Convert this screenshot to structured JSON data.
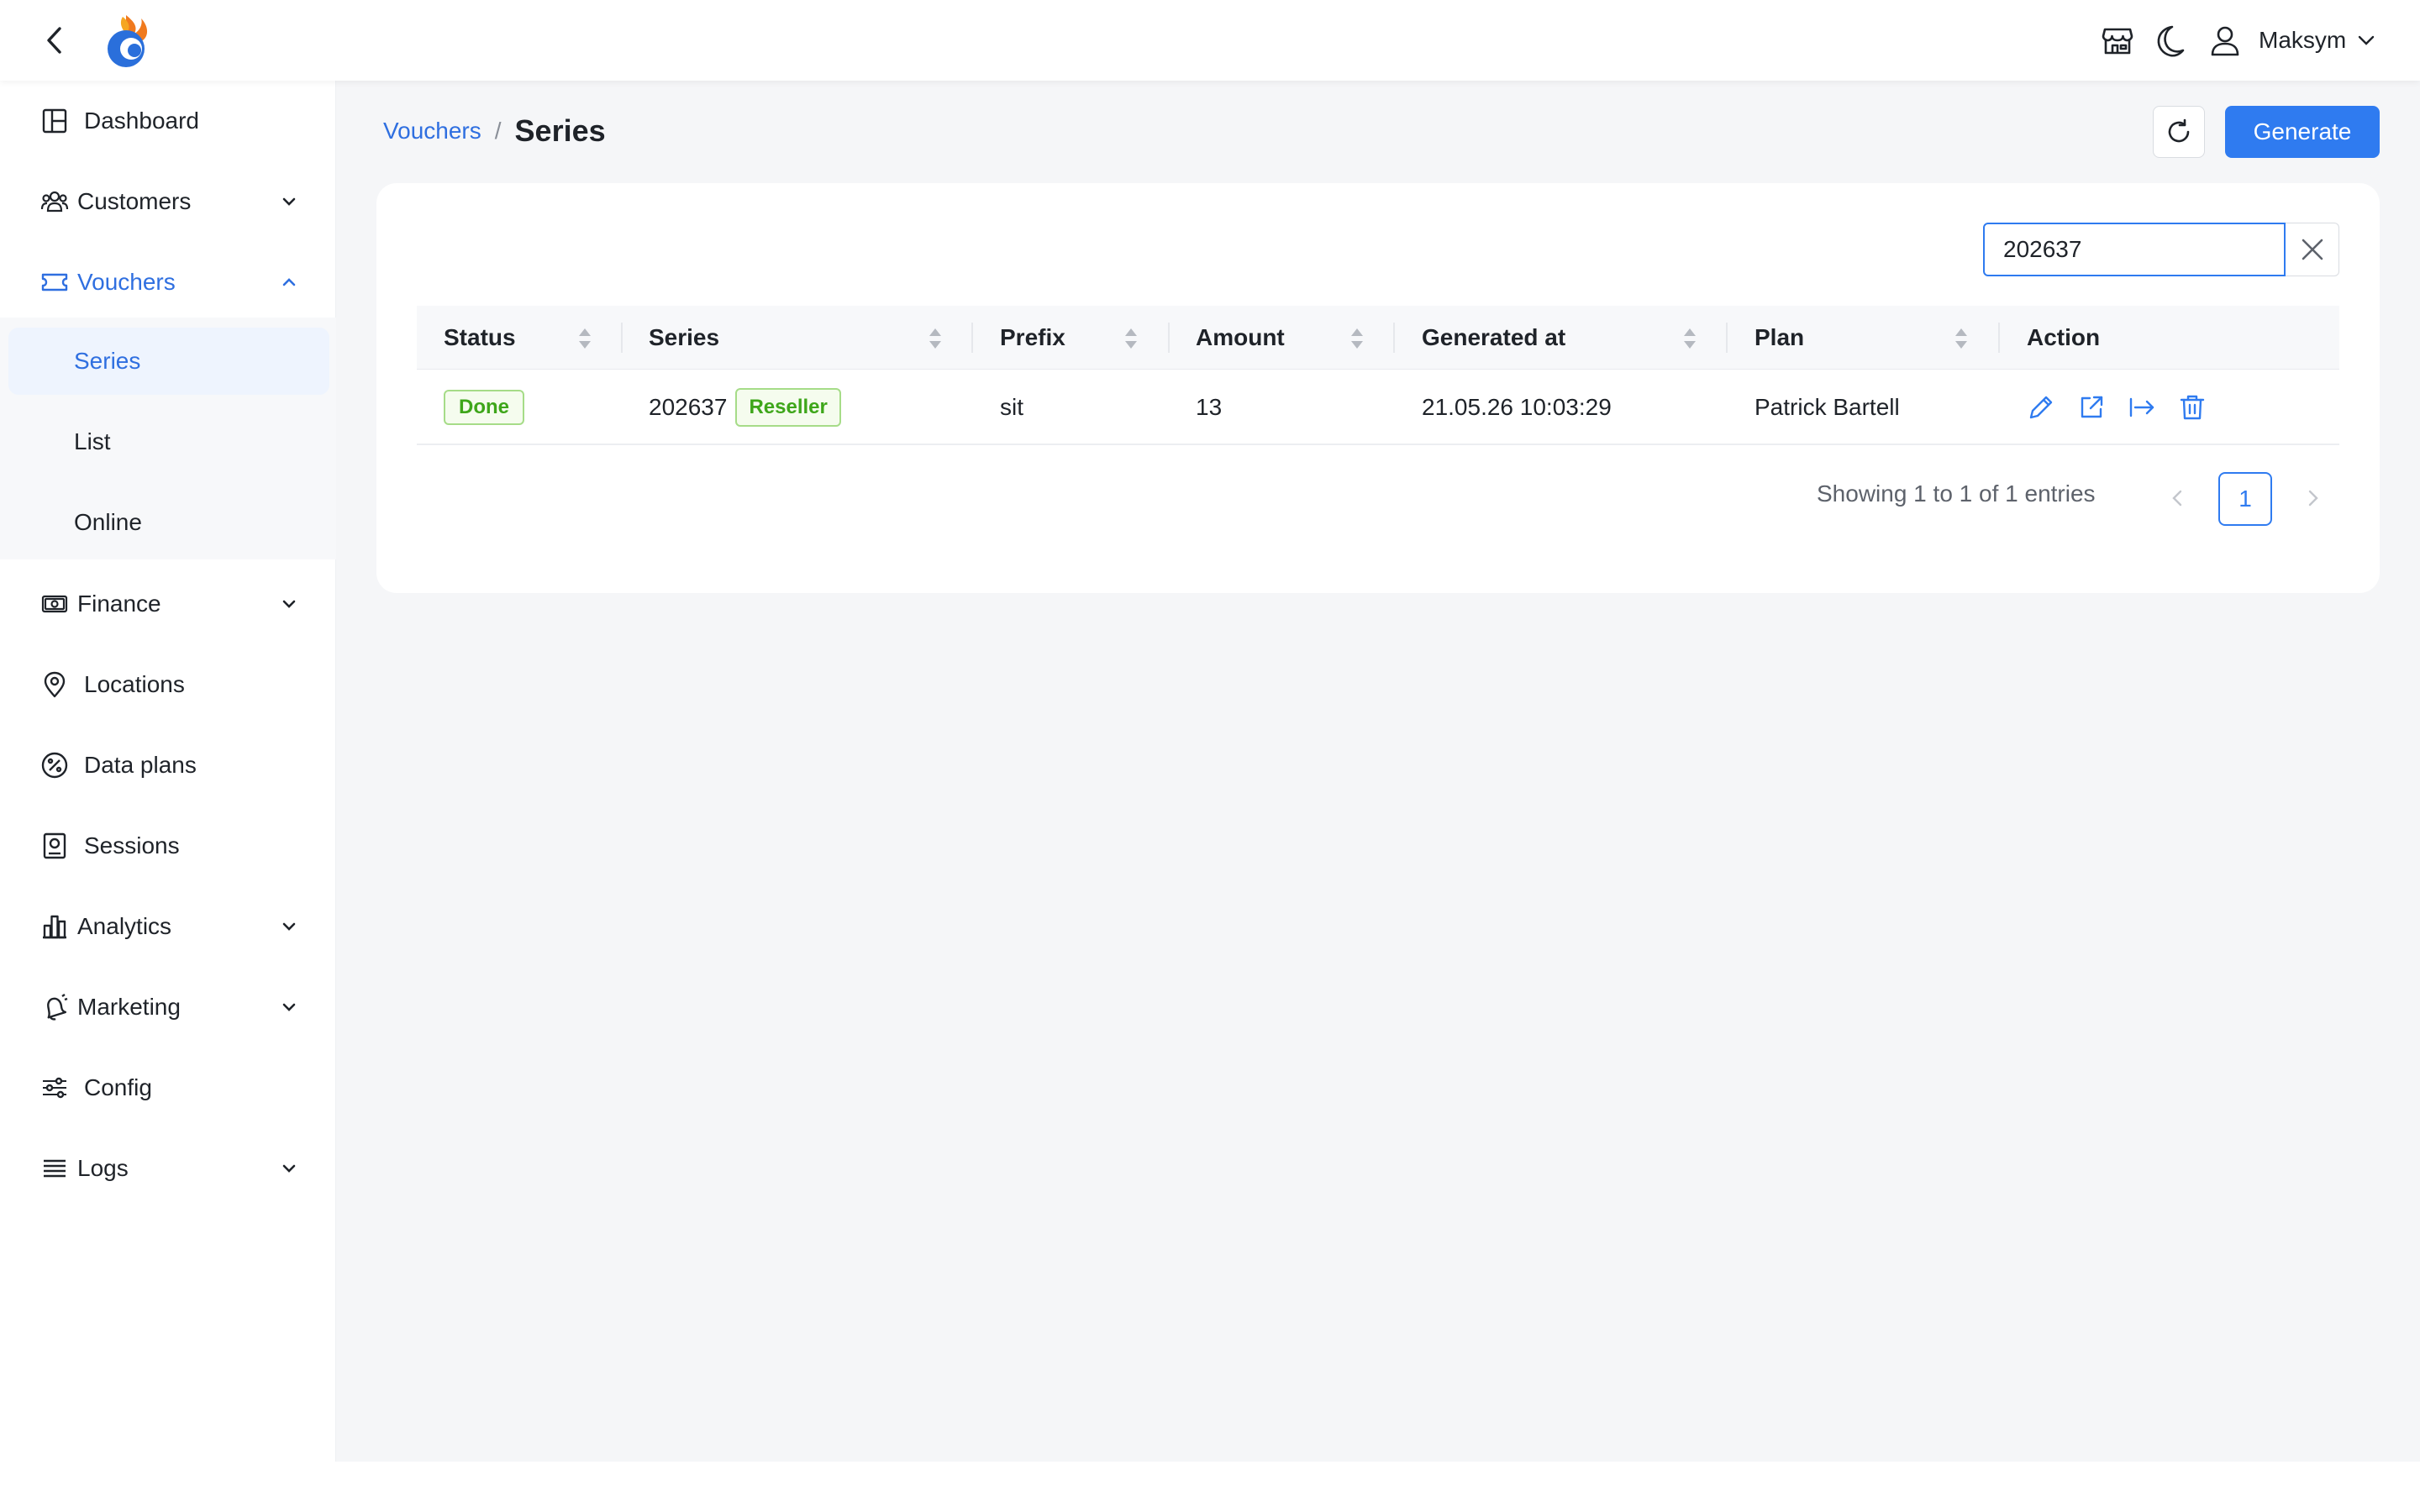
{
  "header": {
    "user_name": "Maksym",
    "icons": [
      "back-icon",
      "logo",
      "store-icon",
      "moon-icon",
      "user-icon",
      "chevron-down-icon"
    ]
  },
  "sidebar": {
    "items": [
      {
        "label": "Dashboard",
        "icon": "dashboard-icon"
      },
      {
        "label": "Customers",
        "icon": "customers-icon",
        "expandable": true
      },
      {
        "label": "Vouchers",
        "icon": "ticket-icon",
        "expandable": true,
        "expanded": true,
        "active": true
      },
      {
        "label": "Finance",
        "icon": "money-icon",
        "expandable": true
      },
      {
        "label": "Locations",
        "icon": "location-pin-icon"
      },
      {
        "label": "Data plans",
        "icon": "percent-icon"
      },
      {
        "label": "Sessions",
        "icon": "sessions-icon"
      },
      {
        "label": "Analytics",
        "icon": "bar-chart-icon",
        "expandable": true
      },
      {
        "label": "Marketing",
        "icon": "bell-icon",
        "expandable": true
      },
      {
        "label": "Config",
        "icon": "sliders-icon"
      },
      {
        "label": "Logs",
        "icon": "list-icon",
        "expandable": true
      }
    ],
    "vouchers_sub": [
      {
        "label": "Series",
        "selected": true
      },
      {
        "label": "List"
      },
      {
        "label": "Online"
      }
    ]
  },
  "breadcrumb": {
    "parent": "Vouchers",
    "separator": "/",
    "current": "Series"
  },
  "toolbar": {
    "generate_label": "Generate"
  },
  "search": {
    "value": "202637"
  },
  "table": {
    "columns": [
      "Status",
      "Series",
      "Prefix",
      "Amount",
      "Generated at",
      "Plan",
      "Action"
    ],
    "rows": [
      {
        "status": "Done",
        "series": "202637",
        "series_tag": "Reseller",
        "prefix": "sit",
        "amount": "13",
        "generated_at": "21.05.26 10:03:29",
        "plan": "Patrick Bartell",
        "actions": [
          "edit-icon",
          "open-external-icon",
          "export-icon",
          "delete-icon"
        ]
      }
    ]
  },
  "pagination": {
    "summary": "Showing 1 to 1 of 1 entries",
    "current_page": "1"
  },
  "colors": {
    "accent": "#2f7bf0",
    "success": "#3ea61a",
    "background": "#f5f6f8"
  }
}
